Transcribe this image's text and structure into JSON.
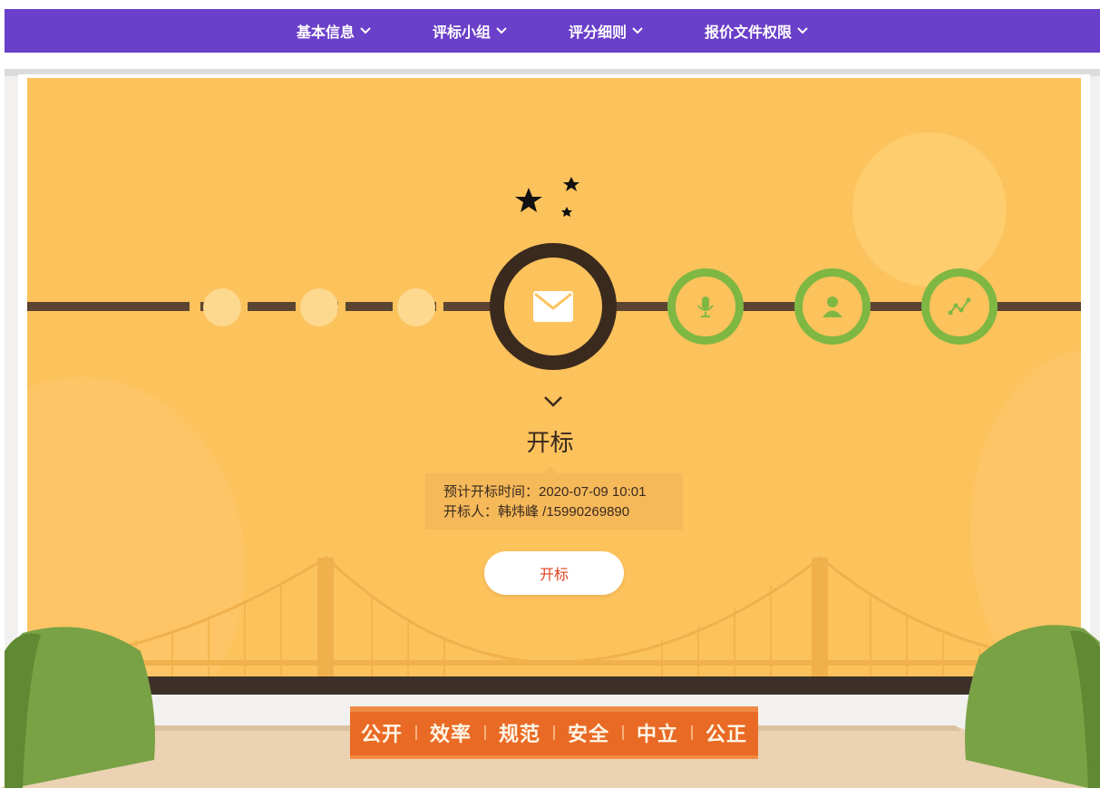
{
  "nav": {
    "items": [
      {
        "label": "基本信息"
      },
      {
        "label": "评标小组"
      },
      {
        "label": "评分细则"
      },
      {
        "label": "报价文件权限"
      }
    ]
  },
  "stage": {
    "title": "开标",
    "info_time": "预计开标时间：2020-07-09 10:01",
    "info_person": "开标人：韩炜峰 /15990269890",
    "button_label": "开标"
  },
  "timeline": {
    "current_icon": "envelope-icon",
    "next_icons": [
      "microphone-icon",
      "person-icon",
      "chart-line-icon"
    ]
  },
  "slogan": {
    "words": [
      "公开",
      "效率",
      "规范",
      "安全",
      "中立",
      "公正"
    ]
  },
  "colors": {
    "nav_bg": "#6a3fc9",
    "board_bg": "#fcc25c",
    "step_green": "#7fb743",
    "button_text": "#e0431f",
    "slogan_bg": "#e96a25"
  }
}
